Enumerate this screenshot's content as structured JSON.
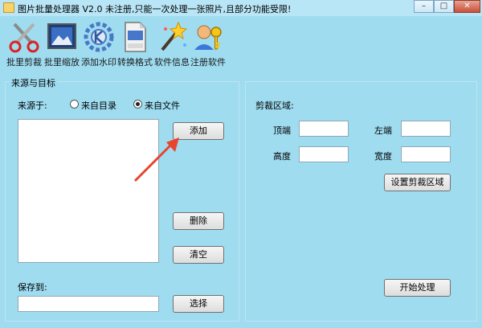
{
  "window": {
    "title": "图片批量处理器 V2.0  未注册,只能一次处理一张照片,且部分功能受限!",
    "minimize_glyph": "–",
    "maximize_glyph": "□",
    "close_glyph": "✕"
  },
  "toolbar": [
    {
      "label": "批里剪裁",
      "icon": "scissors-icon"
    },
    {
      "label": "批里缩放",
      "icon": "picture-icon"
    },
    {
      "label": "添加水印",
      "icon": "kde-gear-icon"
    },
    {
      "label": "转换格式",
      "icon": "jpeg-file-icon"
    },
    {
      "label": "软件信息",
      "icon": "magic-wand-icon"
    },
    {
      "label": "注册软件",
      "icon": "user-key-icon"
    }
  ],
  "source_panel": {
    "legend": "来源与目标",
    "source_label": "来源于:",
    "radio_directory": {
      "label": "来自目录",
      "checked": false
    },
    "radio_file": {
      "label": "来自文件",
      "checked": true
    },
    "add_button": "添加",
    "delete_button": "删除",
    "clear_button": "清空",
    "save_label": "保存到:",
    "save_value": "",
    "choose_button": "选择"
  },
  "crop_panel": {
    "title": "剪裁区域:",
    "top_label": "顶端",
    "left_label": "左端",
    "height_label": "高度",
    "width_label": "宽度",
    "top_value": "",
    "left_value": "",
    "height_value": "",
    "width_value": "",
    "set_area_button": "设置剪裁区域",
    "start_button": "开始处理"
  },
  "colors": {
    "background": "#9fdcf0",
    "arrow": "#e8442e"
  }
}
